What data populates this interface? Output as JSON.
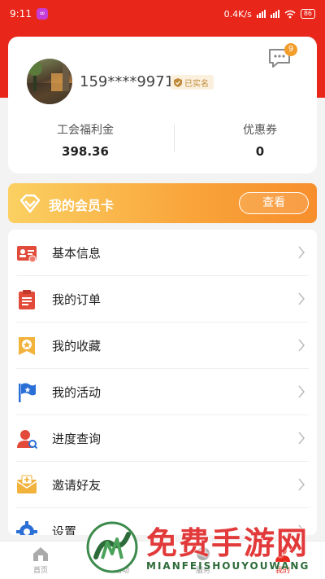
{
  "status_bar": {
    "time": "9:11",
    "speed": "0.4K/s",
    "battery": "86"
  },
  "profile": {
    "phone": "159****9971",
    "verified_label": "已实名",
    "message_count": "9",
    "stats": [
      {
        "label": "工会福利金",
        "value": "398.36"
      },
      {
        "label": "优惠券",
        "value": "0"
      }
    ]
  },
  "member_card": {
    "title": "我的会员卡",
    "button_label": "查看"
  },
  "menu": {
    "items": [
      {
        "label": "基本信息",
        "icon": "id-card-icon"
      },
      {
        "label": "我的订单",
        "icon": "clipboard-icon"
      },
      {
        "label": "我的收藏",
        "icon": "star-badge-icon"
      },
      {
        "label": "我的活动",
        "icon": "flag-icon"
      },
      {
        "label": "进度查询",
        "icon": "user-search-icon"
      },
      {
        "label": "邀请好友",
        "icon": "envelope-icon"
      },
      {
        "label": "设置",
        "icon": "gear-icon"
      }
    ]
  },
  "tabs": [
    {
      "label": "首页",
      "icon": "home-icon"
    },
    {
      "label": "活动",
      "icon": "activity-icon"
    },
    {
      "label": "服务",
      "icon": "service-icon"
    },
    {
      "label": "我的",
      "icon": "person-icon"
    }
  ],
  "watermark": {
    "title": "免费手游网",
    "subtitle": "MIANFEISHOUYOUWANG"
  },
  "colors": {
    "brand_red": "#e8261a",
    "member_orange": "#f9a43a",
    "badge_orange": "#f29d2a",
    "verified_gold": "#c08a3a"
  }
}
